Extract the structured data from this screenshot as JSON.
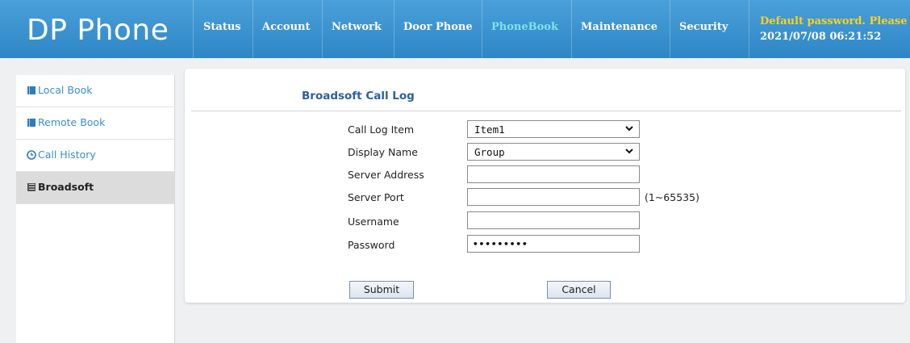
{
  "app": {
    "title": "DP Phone"
  },
  "nav": {
    "items": [
      {
        "label": "Status"
      },
      {
        "label": "Account"
      },
      {
        "label": "Network"
      },
      {
        "label": "Door Phone"
      },
      {
        "label": "PhoneBook",
        "active": true
      },
      {
        "label": "Maintenance"
      },
      {
        "label": "Security"
      }
    ]
  },
  "header": {
    "warning": "Default password. Please",
    "datetime": "2021/07/08 06:21:52"
  },
  "sidebar": {
    "items": [
      {
        "label": "Local Book",
        "icon": "book-icon"
      },
      {
        "label": "Remote Book",
        "icon": "book-icon"
      },
      {
        "label": "Call History",
        "icon": "clock-icon"
      },
      {
        "label": "Broadsoft",
        "icon": "book-icon",
        "active": true
      }
    ]
  },
  "form": {
    "title": "Broadsoft Call Log",
    "call_log_item": {
      "label": "Call Log Item",
      "value": "Item1"
    },
    "display_name": {
      "label": "Display Name",
      "value": "Group"
    },
    "server_address": {
      "label": "Server Address",
      "value": ""
    },
    "server_port": {
      "label": "Server Port",
      "value": "",
      "hint": "(1~65535)"
    },
    "username": {
      "label": "Username",
      "value": ""
    },
    "password": {
      "label": "Password",
      "value": "•••••••••"
    },
    "submit_label": "Submit",
    "cancel_label": "Cancel"
  },
  "colors": {
    "header_blue": "#3a92d0",
    "nav_active": "#7fe3ea",
    "warning": "#ffd21a",
    "link_blue": "#3a8fc8",
    "title_blue": "#2d5fa0"
  }
}
